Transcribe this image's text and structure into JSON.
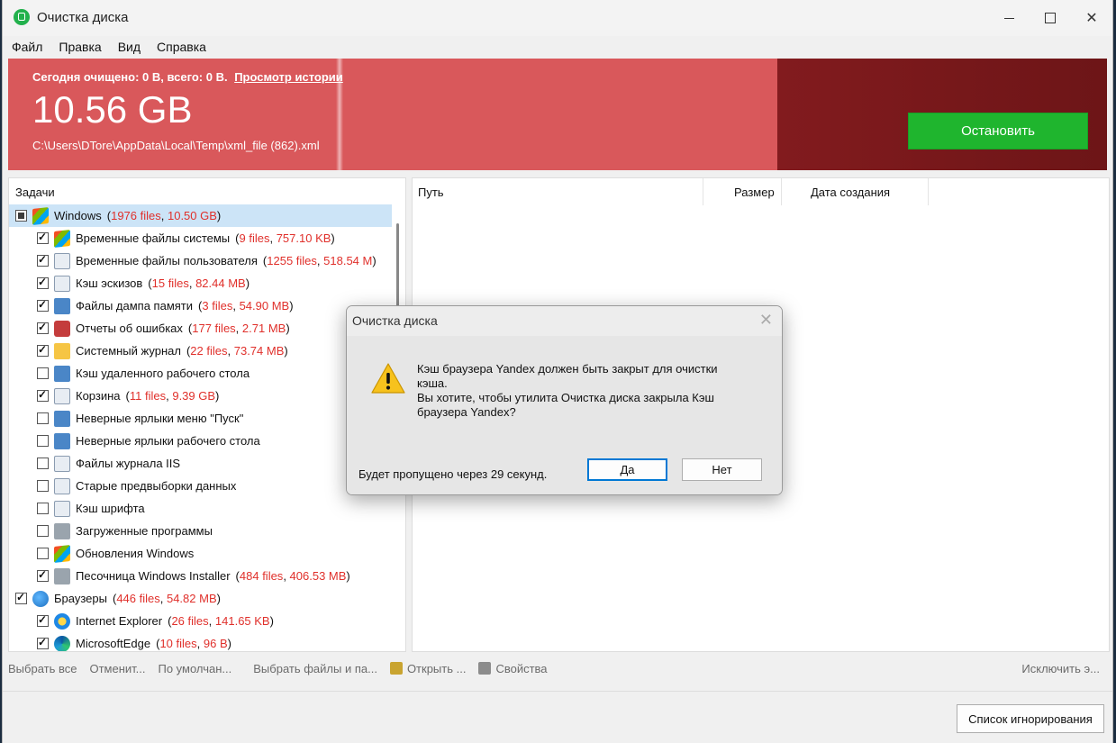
{
  "window": {
    "title": "Очистка диска"
  },
  "menu": [
    "Файл",
    "Правка",
    "Вид",
    "Справка"
  ],
  "banner": {
    "summary": "Сегодня очищено: 0 B, всего: 0 B.",
    "history_link": "Просмотр истории",
    "size": "10.56 GB",
    "path": "C:\\Users\\DTore\\AppData\\Local\\Temp\\xml_file (862).xml",
    "stop_button": "Остановить",
    "colors": {
      "progress": "#d9585b",
      "remaining": "#821b1e",
      "stop": "#1fb52e"
    }
  },
  "tasks": {
    "header": "Задачи",
    "rows": [
      {
        "level": 0,
        "checkbox": "partial",
        "icon": "windows-icon",
        "label": "Windows",
        "files": "1976 files",
        "size": "10.50 GB",
        "selected": true
      },
      {
        "level": 1,
        "checkbox": "checked",
        "icon": "windows-icon",
        "label": "Временные файлы системы",
        "files": "9 files",
        "size": "757.10 KB"
      },
      {
        "level": 1,
        "checkbox": "checked",
        "icon": "user-files-icon",
        "label": "Временные файлы пользователя",
        "files": "1255 files",
        "size": "518.54 M"
      },
      {
        "level": 1,
        "checkbox": "checked",
        "icon": "thumbnail-icon",
        "label": "Кэш эскизов",
        "files": "15 files",
        "size": "82.44 MB"
      },
      {
        "level": 1,
        "checkbox": "checked",
        "icon": "memory-dump-icon",
        "label": "Файлы дампа памяти",
        "files": "3 files",
        "size": "54.90 MB"
      },
      {
        "level": 1,
        "checkbox": "checked",
        "icon": "error-report-icon",
        "label": "Отчеты об ошибках",
        "files": "177 files",
        "size": "2.71 MB"
      },
      {
        "level": 1,
        "checkbox": "checked",
        "icon": "system-log-icon",
        "label": "Системный журнал",
        "files": "22 files",
        "size": "73.74 MB"
      },
      {
        "level": 1,
        "checkbox": "unchecked",
        "icon": "remote-desktop-icon",
        "label": "Кэш удаленного рабочего стола"
      },
      {
        "level": 1,
        "checkbox": "checked",
        "icon": "recycle-bin-icon",
        "label": "Корзина",
        "files": "11 files",
        "size": "9.39 GB"
      },
      {
        "level": 1,
        "checkbox": "unchecked",
        "icon": "start-menu-shortcut-icon",
        "label": "Неверные ярлыки меню \"Пуск\""
      },
      {
        "level": 1,
        "checkbox": "unchecked",
        "icon": "desktop-shortcut-icon",
        "label": "Неверные ярлыки рабочего стола"
      },
      {
        "level": 1,
        "checkbox": "unchecked",
        "icon": "iis-log-icon",
        "label": "Файлы журнала IIS"
      },
      {
        "level": 1,
        "checkbox": "unchecked",
        "icon": "prefetch-icon",
        "label": "Старые предвыборки данных"
      },
      {
        "level": 1,
        "checkbox": "unchecked",
        "icon": "font-cache-icon",
        "label": "Кэш шрифта"
      },
      {
        "level": 1,
        "checkbox": "unchecked",
        "icon": "downloaded-programs-icon",
        "label": "Загруженные программы"
      },
      {
        "level": 1,
        "checkbox": "unchecked",
        "icon": "windows-update-icon",
        "label": "Обновления Windows"
      },
      {
        "level": 1,
        "checkbox": "checked",
        "icon": "installer-icon",
        "label": "Песочница Windows Installer",
        "files": "484 files",
        "size": "406.53 MB"
      },
      {
        "level": 0,
        "checkbox": "checked",
        "icon": "globe-icon",
        "label": "Браузеры",
        "files": "446 files",
        "size": "54.82 MB"
      },
      {
        "level": 1,
        "checkbox": "checked",
        "icon": "internet-explorer-icon",
        "label": "Internet Explorer",
        "files": "26 files",
        "size": "141.65 KB"
      },
      {
        "level": 1,
        "checkbox": "checked",
        "icon": "edge-icon",
        "label": "MicrosoftEdge",
        "files": "10 files",
        "size": "96 B"
      }
    ]
  },
  "files_table": {
    "columns": [
      "Путь",
      "Размер",
      "Дата создания"
    ]
  },
  "toolbar": {
    "select_all": "Выбрать все",
    "cancel": "Отменит...",
    "defaults": "По умолчан...",
    "select_files": "Выбрать файлы и па...",
    "open": "Открыть ...",
    "properties": "Свойства",
    "exclude": "Исключить э..."
  },
  "ignore_button": "Список игнорирования",
  "dialog": {
    "title": "Очистка диска",
    "message_lines": [
      "Кэш браузера Yandex должен быть закрыт для очистки",
      "кэша.",
      "Вы хотите, чтобы утилита Очистка диска закрыла Кэш",
      "браузера Yandex?"
    ],
    "footer": "Будет пропущено через 29 секунд.",
    "yes": "Да",
    "no": "Нет"
  }
}
